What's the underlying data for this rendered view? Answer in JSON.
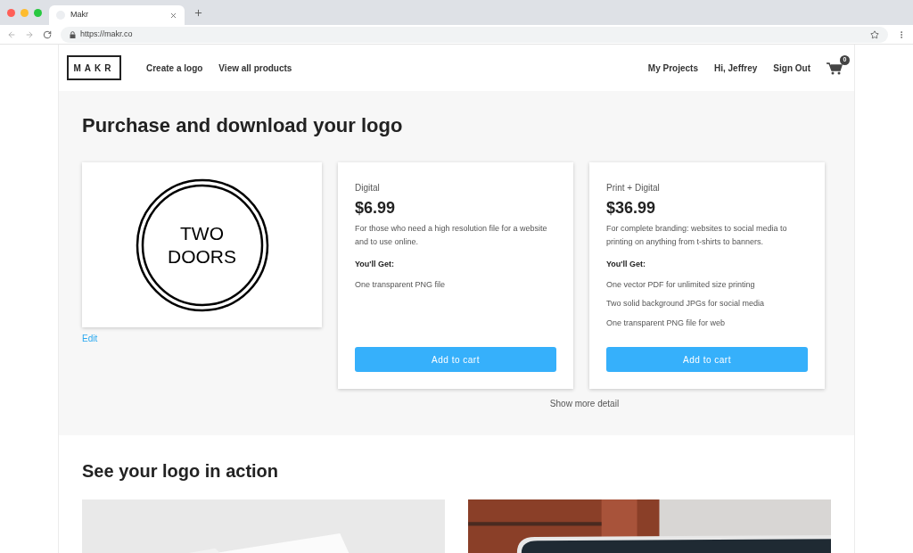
{
  "browser": {
    "tab_title": "Makr",
    "url": "https://makr.co"
  },
  "nav": {
    "logo": "MAKR",
    "left_links": [
      "Create a logo",
      "View all products"
    ],
    "right_links": [
      "My Projects",
      "Hi, Jeffrey",
      "Sign Out"
    ],
    "cart_count": "0"
  },
  "purchase": {
    "title": "Purchase and download your logo",
    "logo_text": [
      "TWO",
      "DOORS"
    ],
    "edit_link": "Edit",
    "plans": [
      {
        "name": "Digital",
        "price": "$6.99",
        "description": "For those who need a high resolution file for a website and to use online.",
        "features_heading": "You'll Get:",
        "features": [
          "One transparent PNG file"
        ],
        "button": "Add to cart"
      },
      {
        "name": "Print + Digital",
        "price": "$36.99",
        "description": "For complete branding: websites to social media to printing on anything from t-shirts to banners.",
        "features_heading": "You'll Get:",
        "features": [
          "One vector PDF for unlimited size printing",
          "Two solid background JPGs for social media",
          "One transparent PNG file for web"
        ],
        "button": "Add to cart"
      }
    ],
    "more_link": "Show more detail"
  },
  "showcase": {
    "title": "See your logo in action"
  }
}
